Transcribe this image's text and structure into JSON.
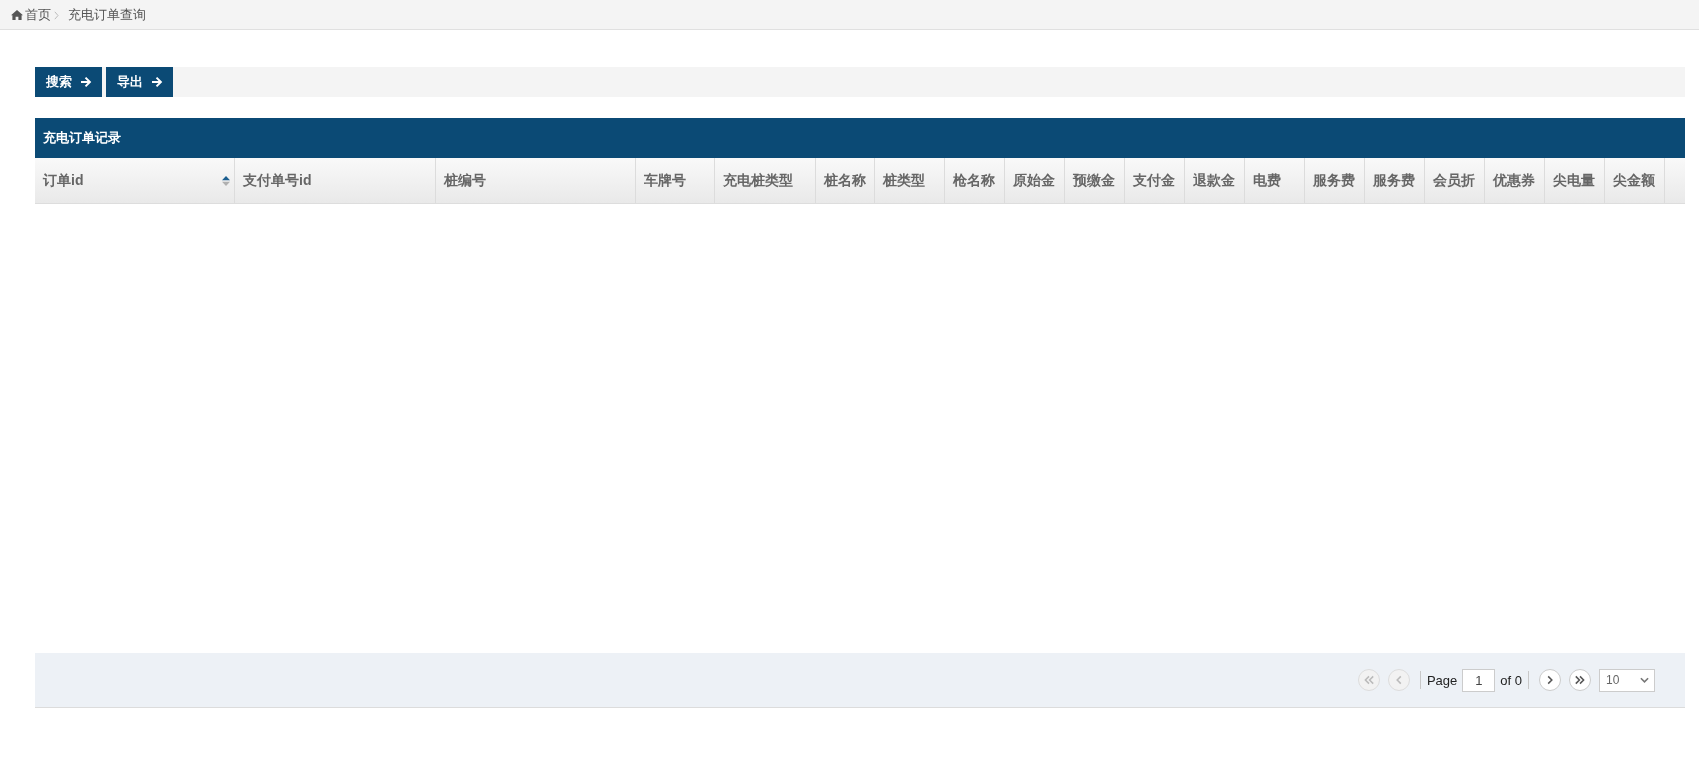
{
  "breadcrumb": {
    "items": [
      {
        "label": "首页",
        "kind": "home"
      },
      {
        "label": "充电订单查询",
        "kind": "current"
      }
    ]
  },
  "toolbar": {
    "buttons": [
      {
        "label": "搜索"
      },
      {
        "label": "导出"
      }
    ]
  },
  "panel": {
    "title": "充电订单记录"
  },
  "table": {
    "columns": [
      {
        "label": "订单id",
        "sorted": true
      },
      {
        "label": "支付单号id",
        "sorted": false
      },
      {
        "label": "桩编号",
        "sorted": false
      },
      {
        "label": "车牌号",
        "sorted": false
      },
      {
        "label": "充电桩类型",
        "sorted": false
      },
      {
        "label": "桩名称",
        "sorted": false
      },
      {
        "label": "桩类型",
        "sorted": false
      },
      {
        "label": "枪名称",
        "sorted": false
      },
      {
        "label": "原始金",
        "sorted": false
      },
      {
        "label": "预缴金",
        "sorted": false
      },
      {
        "label": "支付金",
        "sorted": false
      },
      {
        "label": "退款金",
        "sorted": false
      },
      {
        "label": "电费",
        "sorted": false
      },
      {
        "label": "服务费",
        "sorted": false
      },
      {
        "label": "服务费",
        "sorted": false
      },
      {
        "label": "会员折",
        "sorted": false
      },
      {
        "label": "优惠券",
        "sorted": false
      },
      {
        "label": "尖电量",
        "sorted": false
      },
      {
        "label": "尖金额",
        "sorted": false
      }
    ]
  },
  "pager": {
    "nav_start": [
      {
        "kind": "first",
        "disabled": true
      },
      {
        "kind": "prev",
        "disabled": true
      }
    ],
    "page_label": "Page",
    "page_value": "1",
    "page_total": "of 0",
    "nav_end": [
      {
        "kind": "next",
        "disabled": false
      },
      {
        "kind": "last",
        "disabled": false
      }
    ],
    "page_size": "10"
  }
}
